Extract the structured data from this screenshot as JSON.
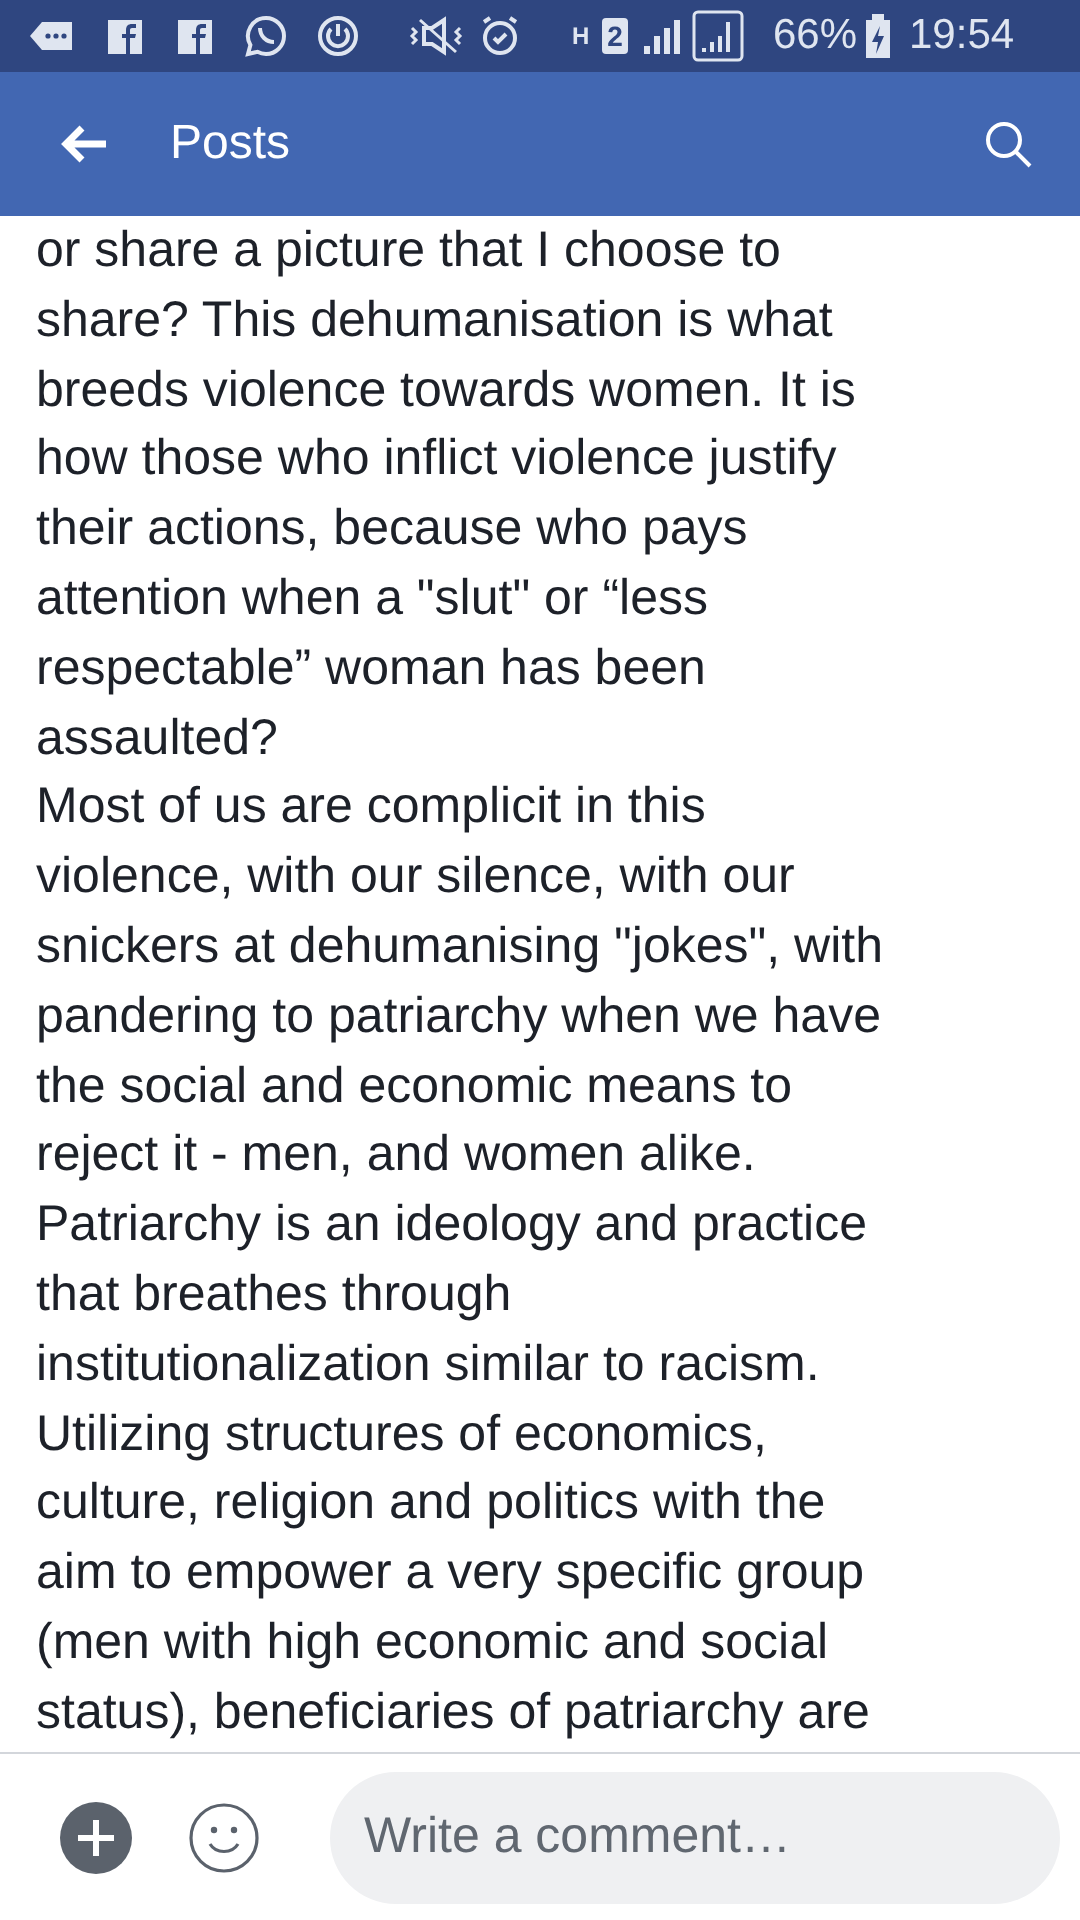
{
  "status_bar": {
    "network": "H",
    "sim": "2",
    "battery": "66%",
    "time": "19:54"
  },
  "app_bar": {
    "title": "Posts"
  },
  "post_paragraphs": [
    {
      "lines": [
        "or share a picture that I choose to",
        "share? This dehumanisation is what",
        "breeds violence towards women. It is",
        "how those who inflict violence justify",
        "their actions, because who pays",
        "attention when a \"slut\" or “less",
        "respectable” woman has been",
        "assaulted?"
      ]
    },
    {
      "lines": [
        "Most of us are complicit in this",
        "violence, with our silence, with our",
        "snickers at dehumanising \"jokes\", with",
        "pandering to patriarchy when we have",
        "the social and economic means to",
        "reject it - men, and women alike."
      ]
    },
    {
      "lines": [
        "Patriarchy is an ideology and practice",
        "that breathes through",
        "institutionalization similar to racism."
      ]
    },
    {
      "lines": [
        "Utilizing structures of economics,",
        "culture, religion and politics with the",
        "aim to empower a very specific group",
        "(men with high economic and social",
        "status), beneficiaries of patriarchy are"
      ]
    }
  ],
  "composer": {
    "placeholder": "Write a comment…"
  }
}
